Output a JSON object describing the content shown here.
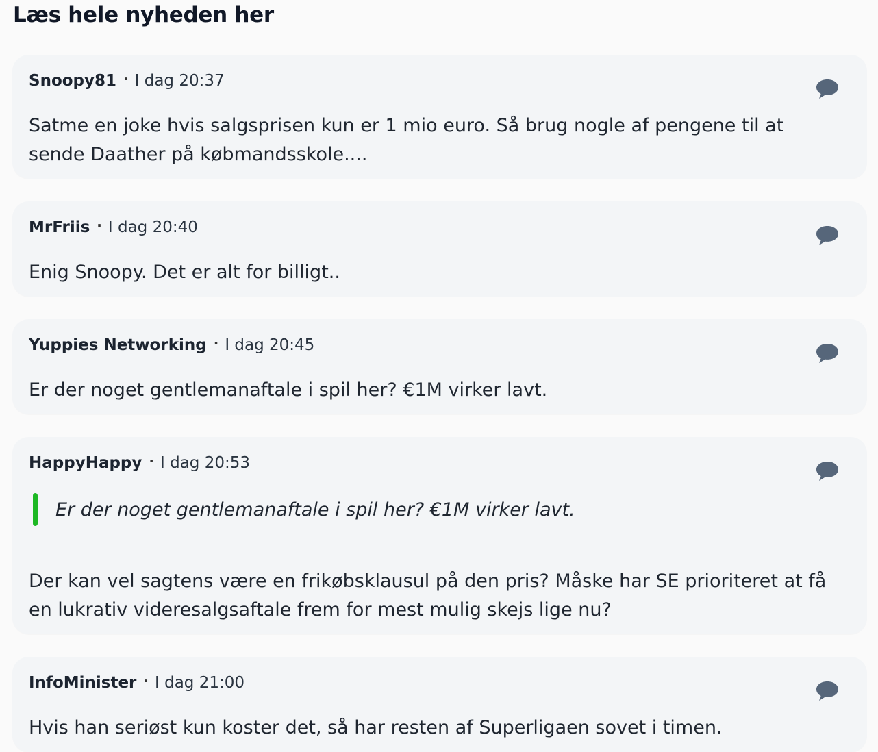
{
  "heading": "Læs hele nyheden her",
  "comments": [
    {
      "author": "Snoopy81",
      "time": "I dag 20:37",
      "text": "Satme en joke hvis salgsprisen kun er 1 mio euro. Så brug nogle af pengene til at sende Daather på købmandsskole...."
    },
    {
      "author": "MrFriis",
      "time": "I dag 20:40",
      "text": "Enig Snoopy. Det er alt for billigt.."
    },
    {
      "author": "Yuppies Networking",
      "time": "I dag 20:45",
      "text": "Er der noget gentlemanaftale i spil her? €1M virker lavt."
    },
    {
      "author": "HappyHappy",
      "time": "I dag 20:53",
      "quote": "Er der noget gentlemanaftale i spil her? €1M virker lavt.",
      "text": "Der kan vel sagtens være en frikøbsklausul på den pris? Måske har SE prioriteret at få en lukrativ videresalgsaftale frem for mest mulig skejs lige nu?"
    },
    {
      "author": "InfoMinister",
      "time": "I dag 21:00",
      "text": "Hvis han seriøst kun koster det, så har resten af Superligaen sovet i timen."
    }
  ],
  "icons": {
    "reply": "speech-bubble-icon"
  },
  "colors": {
    "card_background": "#f3f5f7",
    "quote_bar": "#1db824",
    "icon": "#56667a"
  }
}
